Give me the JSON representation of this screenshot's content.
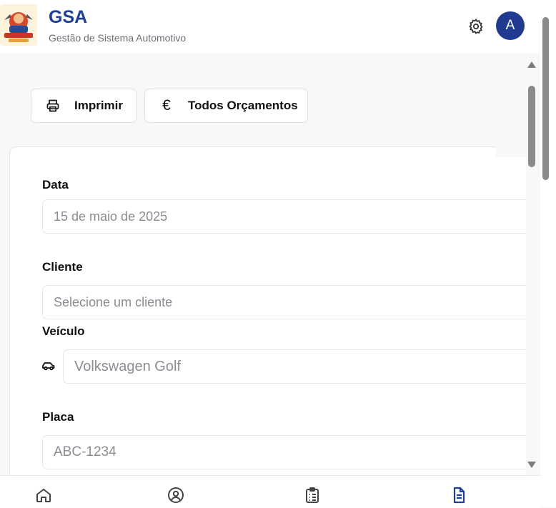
{
  "header": {
    "title": "GSA",
    "subtitle": "Gestão de Sistema Automotivo",
    "avatar_initial": "A",
    "logo_icon": "garage-logo",
    "settings_icon": "gear-icon"
  },
  "toolbar": {
    "print_label": "Imprimir",
    "print_icon": "printer-icon",
    "budgets_label": "Todos Orçamentos",
    "budgets_icon": "euro-icon",
    "budgets_icon_glyph": "€"
  },
  "form": {
    "date": {
      "label": "Data",
      "value": "15 de maio de 2025"
    },
    "client": {
      "label": "Cliente",
      "placeholder": "Selecione um cliente"
    },
    "vehicle": {
      "label": "Veículo",
      "placeholder": "Volkswagen Golf",
      "icon": "car-icon"
    },
    "plate": {
      "label": "Placa",
      "placeholder": "ABC-1234"
    }
  },
  "bottom_nav": {
    "items": [
      {
        "icon": "home-icon",
        "active": false
      },
      {
        "icon": "user-circle-icon",
        "active": false
      },
      {
        "icon": "clipboard-list-icon",
        "active": false
      },
      {
        "icon": "document-icon",
        "active": true
      }
    ]
  },
  "colors": {
    "brand": "#1f3f95",
    "avatar_bg": "#1f3a8f",
    "background": "#f7f8fa",
    "placeholder_text": "#8a8d93"
  }
}
